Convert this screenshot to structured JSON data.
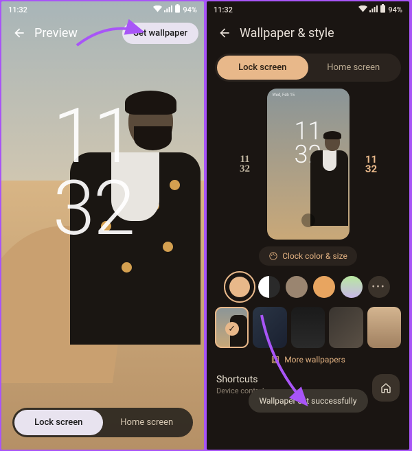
{
  "status": {
    "time": "11:32",
    "battery": "94%"
  },
  "left": {
    "title": "Preview",
    "set_wallpaper": "Set wallpaper",
    "clock_hour": "11",
    "clock_min": "32",
    "tabs": {
      "lock": "Lock screen",
      "home": "Home screen"
    }
  },
  "right": {
    "title": "Wallpaper & style",
    "tabs": {
      "lock": "Lock screen",
      "home": "Home screen"
    },
    "mini_time_top": "Wed, Feb 15",
    "clock_hour": "11",
    "clock_min": "32",
    "clock_chip": "Clock color & size",
    "colors": [
      "#e8b88a",
      "bw",
      "#9a8570",
      "#e8a560",
      "#b8e8a0",
      "#c8b8e8"
    ],
    "more_wallpapers": "More wallpapers",
    "shortcuts": {
      "title": "Shortcuts",
      "sub": "Device controls"
    },
    "toast": "Wallpaper set successfully"
  }
}
